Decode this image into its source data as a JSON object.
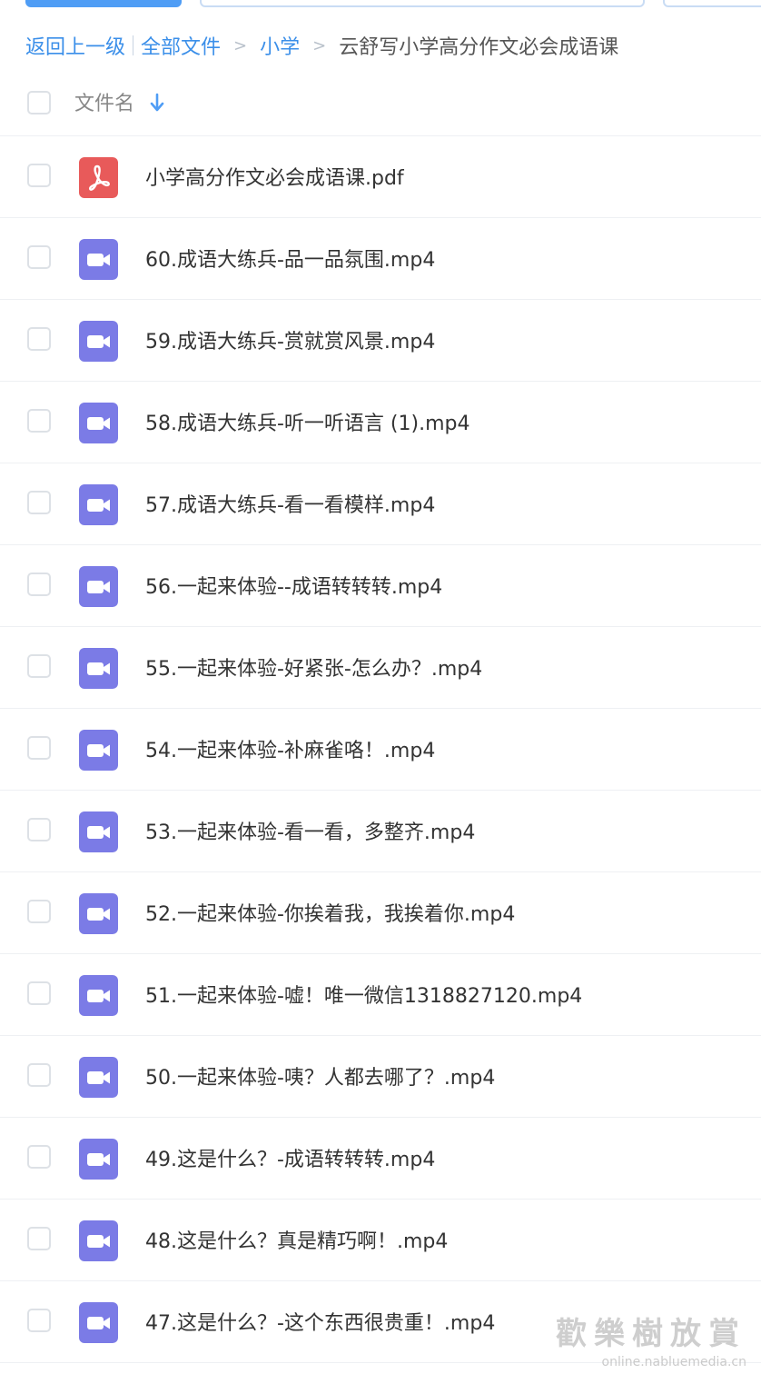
{
  "breadcrumb": {
    "back": "返回上一级",
    "all_files": "全部文件",
    "level1": "小学",
    "current": "云舒写小学高分作文必会成语课",
    "separator": ">"
  },
  "header": {
    "column_label": "文件名",
    "sort_icon": "arrow-down-icon"
  },
  "colors": {
    "link": "#3b8fe9",
    "pdf_icon": "#e85a5a",
    "video_icon": "#7b7be6"
  },
  "files": [
    {
      "name": "小学高分作文必会成语课.pdf",
      "type": "pdf"
    },
    {
      "name": "60.成语大练兵-品一品氛围.mp4",
      "type": "video"
    },
    {
      "name": "59.成语大练兵-赏就赏风景.mp4",
      "type": "video"
    },
    {
      "name": "58.成语大练兵-听一听语言 (1).mp4",
      "type": "video"
    },
    {
      "name": "57.成语大练兵-看一看模样.mp4",
      "type": "video"
    },
    {
      "name": "56.一起来体验--成语转转转.mp4",
      "type": "video"
    },
    {
      "name": "55.一起来体验-好紧张-怎么办？.mp4",
      "type": "video"
    },
    {
      "name": "54.一起来体验-补麻雀咯！.mp4",
      "type": "video"
    },
    {
      "name": "53.一起来体验-看一看，多整齐.mp4",
      "type": "video"
    },
    {
      "name": "52.一起来体验-你挨着我，我挨着你.mp4",
      "type": "video"
    },
    {
      "name": "51.一起来体验-嘘！唯一微信1318827120.mp4",
      "type": "video"
    },
    {
      "name": "50.一起来体验-咦？人都去哪了？.mp4",
      "type": "video"
    },
    {
      "name": "49.这是什么？-成语转转转.mp4",
      "type": "video"
    },
    {
      "name": "48.这是什么？真是精巧啊！.mp4",
      "type": "video"
    },
    {
      "name": "47.这是什么？-这个东西很贵重！.mp4",
      "type": "video"
    }
  ],
  "watermark": {
    "title": "歡樂樹放賞",
    "url": "online.nabluemedia.cn"
  }
}
